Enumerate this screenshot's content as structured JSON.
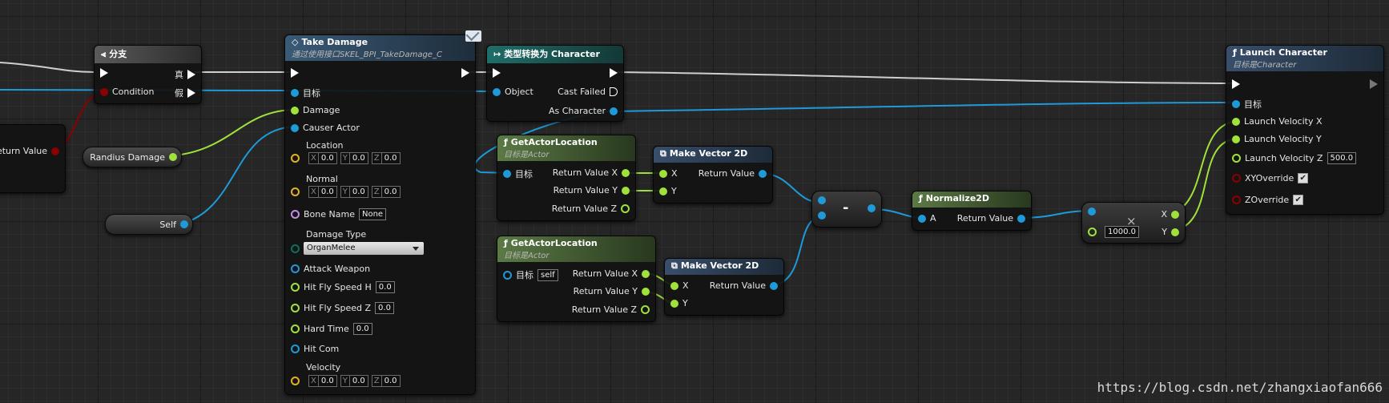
{
  "colors": {
    "exec": "#ffffff",
    "object": "#1e9ad8",
    "float": "#9ee23a",
    "struct_vector": "#e3b21f",
    "bool": "#8b0000",
    "name": "#c98ae5",
    "byte": "#0a6f62",
    "int": "#1fe3a3"
  },
  "left_partial": {
    "label": "eturn Value"
  },
  "branch": {
    "title": "分支",
    "icon": "branch-icon",
    "true_label": "真",
    "false_label": "假",
    "condition_label": "Condition"
  },
  "randius": {
    "label": "Randius Damage"
  },
  "self_var": {
    "label": "Self"
  },
  "take_damage": {
    "title": "Take Damage",
    "subtitle": "通过使用接口SKEL_BPI_TakeDamage_C",
    "target": "目标",
    "damage": "Damage",
    "causer": "Causer Actor",
    "location": "Location",
    "location_x": "0.0",
    "location_y": "0.0",
    "location_z": "0.0",
    "normal": "Normal",
    "normal_x": "0.0",
    "normal_y": "0.0",
    "normal_z": "0.0",
    "bone_name": "Bone Name",
    "bone_name_value": "None",
    "damage_type": "Damage Type",
    "damage_type_value": "OrganMelee",
    "attack_weapon": "Attack Weapon",
    "hit_fly_h": "Hit Fly Speed H",
    "hit_fly_h_value": "0.0",
    "hit_fly_z": "Hit Fly Speed Z",
    "hit_fly_z_value": "0.0",
    "hard_time": "Hard Time",
    "hard_time_value": "0.0",
    "hit_com": "Hit Com",
    "velocity": "Velocity",
    "velocity_x": "0.0",
    "velocity_y": "0.0",
    "velocity_z": "0.0",
    "axis_x": "X",
    "axis_y": "Y",
    "axis_z": "Z"
  },
  "cast": {
    "title": "类型转换为 Character",
    "object": "Object",
    "cast_failed": "Cast Failed",
    "as_character": "As Character"
  },
  "get_loc1": {
    "title": "GetActorLocation",
    "subtitle": "目标是Actor",
    "target": "目标",
    "rx": "Return Value X",
    "ry": "Return Value Y",
    "rz": "Return Value Z"
  },
  "get_loc2": {
    "title": "GetActorLocation",
    "subtitle": "目标是Actor",
    "target": "目标",
    "target_value": "self",
    "rx": "Return Value X",
    "ry": "Return Value Y",
    "rz": "Return Value Z"
  },
  "make_vec1": {
    "title": "Make Vector 2D",
    "x": "X",
    "y": "Y",
    "ret": "Return Value"
  },
  "make_vec2": {
    "title": "Make Vector 2D",
    "x": "X",
    "y": "Y",
    "ret": "Return Value"
  },
  "minus": {
    "symbol": "-"
  },
  "normalize": {
    "title": "Normalize2D",
    "a": "A",
    "ret": "Return Value"
  },
  "multiply": {
    "symbol": "×",
    "value": "1000.0",
    "x": "X",
    "y": "Y"
  },
  "launch": {
    "title": "Launch Character",
    "subtitle": "目标是Character",
    "target": "目标",
    "vx": "Launch Velocity X",
    "vy": "Launch Velocity Y",
    "vz": "Launch Velocity Z",
    "vz_value": "500.0",
    "xy_override": "XYOverride",
    "z_override": "ZOverride"
  },
  "watermark": "https://blog.csdn.net/zhangxiaofan666"
}
